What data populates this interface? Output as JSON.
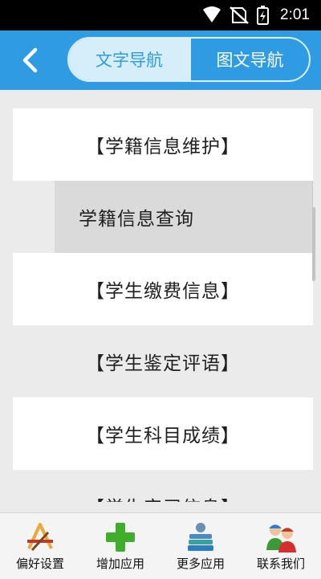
{
  "status_bar": {
    "time": "2:01",
    "icons": [
      "wifi-icon",
      "no-sim-icon",
      "battery-charging-icon"
    ]
  },
  "header": {
    "back_icon": "chevron-left-icon",
    "tabs": [
      {
        "label": "文字导航",
        "active": true
      },
      {
        "label": "图文导航",
        "active": false
      }
    ],
    "accent_color": "#2e9be3"
  },
  "menu": {
    "items": [
      {
        "label": "【学籍信息维护】",
        "type": "category"
      },
      {
        "label": "学籍信息查询",
        "type": "submenu"
      },
      {
        "label": "【学生缴费信息】",
        "type": "category"
      },
      {
        "label": "【学生鉴定评语】",
        "type": "category"
      },
      {
        "label": "【学生科目成绩】",
        "type": "category"
      },
      {
        "label": "【学生实习信息】",
        "type": "category"
      }
    ]
  },
  "bottom_nav": [
    {
      "label": "偏好设置",
      "icon": "pencil-ruler-icon"
    },
    {
      "label": "增加应用",
      "icon": "plus-icon"
    },
    {
      "label": "更多应用",
      "icon": "stacked-books-icon"
    },
    {
      "label": "联系我们",
      "icon": "people-icon"
    }
  ]
}
